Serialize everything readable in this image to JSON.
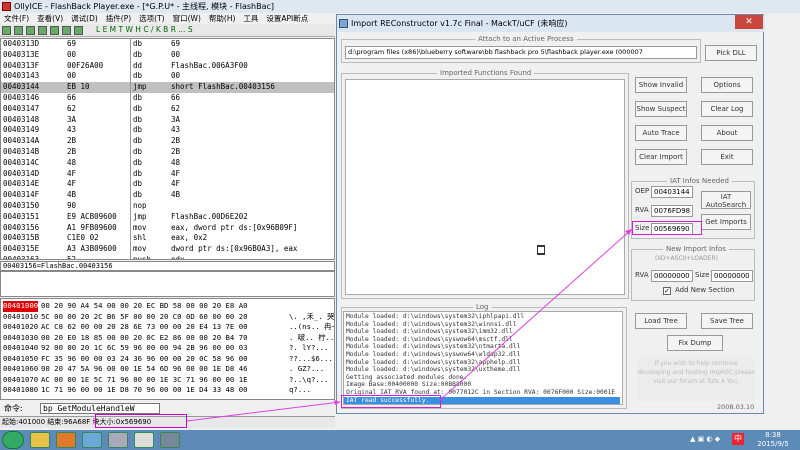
{
  "olly": {
    "title": "OllyICE - FlashBack Player.exe - [*G.P.U* - 主线程, 模块 - FlashBac]",
    "menu": [
      "文件(F)",
      "查看(V)",
      "调试(D)",
      "插件(P)",
      "选项(T)",
      "窗口(W)",
      "帮助(H)",
      "工具",
      "设置API断点"
    ],
    "toolbar_letters": "L E M T W H C / K B R ... S",
    "rows": [
      {
        "addr": "0040313D",
        "hex": "69",
        "op": "db",
        "arg": "69"
      },
      {
        "addr": "0040313E",
        "hex": "00",
        "op": "db",
        "arg": "00"
      },
      {
        "addr": "0040313F",
        "hex": "00F26A00",
        "op": "dd",
        "arg": "FlashBac.006A3F00"
      },
      {
        "addr": "00403143",
        "hex": "00",
        "op": "db",
        "arg": "00"
      },
      {
        "addr": "00403144",
        "hex": "EB 10",
        "op": "jmp",
        "arg": "short FlashBac.00403156"
      },
      {
        "addr": "00403146",
        "hex": "66",
        "op": "db",
        "arg": "66"
      },
      {
        "addr": "00403147",
        "hex": "62",
        "op": "db",
        "arg": "62"
      },
      {
        "addr": "00403148",
        "hex": "3A",
        "op": "db",
        "arg": "3A"
      },
      {
        "addr": "00403149",
        "hex": "43",
        "op": "db",
        "arg": "43"
      },
      {
        "addr": "0040314A",
        "hex": "2B",
        "op": "db",
        "arg": "2B"
      },
      {
        "addr": "0040314B",
        "hex": "2B",
        "op": "db",
        "arg": "2B"
      },
      {
        "addr": "0040314C",
        "hex": "48",
        "op": "db",
        "arg": "48"
      },
      {
        "addr": "0040314D",
        "hex": "4F",
        "op": "db",
        "arg": "4F"
      },
      {
        "addr": "0040314E",
        "hex": "4F",
        "op": "db",
        "arg": "4F"
      },
      {
        "addr": "0040314F",
        "hex": "4B",
        "op": "db",
        "arg": "4B"
      },
      {
        "addr": "00403150",
        "hex": "90",
        "op": "nop",
        "arg": ""
      },
      {
        "addr": "00403151",
        "hex": "E9 ACB09600",
        "op": "jmp",
        "arg": "FlashBac.00D6E202"
      },
      {
        "addr": "00403156",
        "hex": "A1 9FB09600",
        "op": "mov",
        "arg": "eax, dword ptr ds:[0x96B09F]"
      },
      {
        "addr": "0040315B",
        "hex": "C1E0 02",
        "op": "shl",
        "arg": "eax, 0x2"
      },
      {
        "addr": "0040315E",
        "hex": "A3 A3B09600",
        "op": "mov",
        "arg": "dword ptr ds:[0x96B0A3], eax"
      },
      {
        "addr": "00403163",
        "hex": "52",
        "op": "push",
        "arg": "edx"
      },
      {
        "addr": "00403164",
        "hex": "6A 00",
        "op": "push",
        "arg": "0x0"
      }
    ],
    "info_line": "00403156=FlashBac.00403156",
    "dump": [
      {
        "addr": "00401000",
        "bytes": "00 20 90 A4 54 00 00 20 EC BD 58 00 00 20 E8 A0",
        "ascii": ""
      },
      {
        "addr": "00401010",
        "bytes": "5C 00 00 20 2C B6 5F 00 00 20 C0 0D 60 00 00 20",
        "ascii": "\\. ,禾_. 哭`."
      },
      {
        "addr": "00401020",
        "bytes": "AC C8 62 00 00 20 28 6E 73 00 00 20 E4 13 7E 00",
        "ascii": "..(ns.. 冉~."
      },
      {
        "addr": "00401030",
        "bytes": "00 20 E0 18 85 00 00 20 0C E2 86 00 00 20 B4 70",
        "ascii": ". 啵.. 柠..."
      },
      {
        "addr": "00401040",
        "bytes": "92 00 00 20 1C 6C 59 96 00 00 94 2B 96 00 00 03",
        "ascii": "?. lY?..."
      },
      {
        "addr": "00401050",
        "bytes": "FC 35 96 00 00 03 24 36 96 00 00 20 0C 58 96 00",
        "ascii": "??...$6..."
      },
      {
        "addr": "00401060",
        "bytes": "00 20 47 5A 96 00 00 1E 54 6D 96 00 00 1E D8 46",
        "ascii": ". GZ?..."
      },
      {
        "addr": "00401070",
        "bytes": "AC 00 00 1E 5C 71 96 00 00 1E 3C 71 96 00 00 1E",
        "ascii": "?..\\q?..."
      },
      {
        "addr": "00401080",
        "bytes": "1C 71 96 00 00 1E D8 70 96 00 00 1E D4 33 48 00",
        "ascii": "q?..."
      }
    ],
    "cmd_label": "命令:",
    "cmd_value": "bp GetModuleHandleW",
    "status": "起始:401000  结束:96A68F  块大小:0x569690"
  },
  "imprec": {
    "title": "Import REConstructor v1.7c Final - MackT/uCF (未响应)",
    "close": "✕",
    "attach_label": "Attach to an Active Process",
    "process_value": "d:\\program files (x86)\\blueberry software\\bb flashback pro 5\\flashback player.exe (000007",
    "pick_dll": "Pick DLL",
    "imported_label": "Imported Functions Found",
    "btn_show_invalid": "Show Invalid",
    "btn_show_suspect": "Show Suspect",
    "btn_auto_trace": "Auto Trace",
    "btn_clear_imports": "Clear Import",
    "btn_options": "Options",
    "btn_clear_log": "Clear Log",
    "btn_about": "About",
    "btn_exit": "Exit",
    "iat_label": "IAT Infos Needed",
    "oep_label": "OEP",
    "oep_value": "00403144",
    "rva_label": "RVA",
    "rva_value": "0076FD98",
    "size_label": "Size",
    "size_value": "00569690",
    "btn_iat_autosearch": "IAT AutoSearch",
    "btn_get_imports": "Get Imports",
    "new_import_label": "New Import Infos",
    "new_import_sub": "(IID+ASCII+LOADER)",
    "new_rva_label": "RVA",
    "new_rva_value": "00000000",
    "new_size_label": "Size",
    "new_size_value": "00000000",
    "add_new_section": "Add New Section",
    "add_new_section_checked": true,
    "log_label": "Log",
    "log": [
      "Module loaded: d:\\windows\\system32\\iphlpapi.dll",
      "Module loaded: d:\\windows\\system32\\winnsi.dll",
      "Module loaded: d:\\windows\\system32\\imm32.dll",
      "Module loaded: d:\\windows\\syswow64\\msctf.dll",
      "Module loaded: d:\\windows\\system32\\ntmarta.dll",
      "Module loaded: d:\\windows\\syswow64\\wldap32.dll",
      "Module loaded: d:\\windows\\system32\\apphelp.dll",
      "Module loaded: d:\\windows\\system32\\uxtheme.dll",
      "Getting associated modules done.",
      "Image Base:00400000 Size:00BB8000",
      "Original IAT RVA found at: 0077012C in Section RVA: 0076F000 Size:0001E",
      "IAT read successfully."
    ],
    "btn_load_tree": "Load Tree",
    "btn_save_tree": "Save Tree",
    "btn_fix_dump": "Fix Dump",
    "promo": "If you wish to help continue developing and hosting ImpREC please visit our forum at Tuts 4 You.",
    "date": "2008.03.10"
  },
  "taskbar": {
    "time": "8:38",
    "date": "2015/9/5",
    "lang": "中",
    "apps": [
      "folder-icon",
      "media-player-icon",
      "network-icon",
      "ollyice-icon",
      "imprec-icon",
      "app-icon"
    ]
  }
}
